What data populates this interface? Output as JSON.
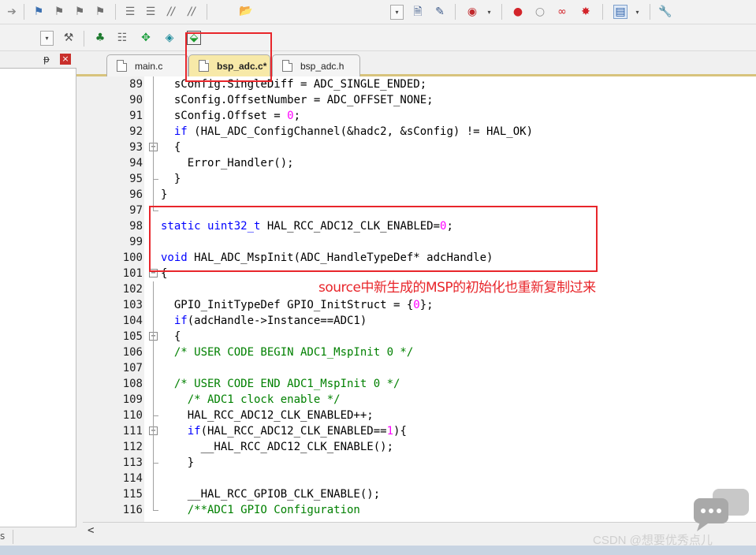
{
  "toolbar1": {
    "icons": [
      "forward-arrow-icon",
      "bookmark-set-icon",
      "bookmark-prev-icon",
      "bookmark-next-icon",
      "bookmark-clear-icon",
      "indent-icon",
      "unindent-icon",
      "comment-icon",
      "uncomment-icon",
      "open-project-icon",
      "file-find-icon",
      "incremental-find-icon",
      "debug-start-icon",
      "breakpoint-insert-icon",
      "breakpoint-enable-icon",
      "breakpoint-disable-icon",
      "breakpoint-kill-all-icon",
      "window-layout-icon",
      "configure-icon"
    ],
    "dropdown_glyph": "▾"
  },
  "toolbar2": {
    "icons": [
      "target-options-icon",
      "manage-components-icon",
      "select-packs-icon",
      "run-time-env-icon",
      "pack-installer-icon",
      "batch-build-icon"
    ]
  },
  "left_panel": {
    "pin_glyph": "ᵽ",
    "close_glyph": "×",
    "footer_text": "s"
  },
  "tabs": [
    {
      "label": "main.c",
      "active": false
    },
    {
      "label": "bsp_adc.c*",
      "active": true
    },
    {
      "label": "bsp_adc.h",
      "active": false
    }
  ],
  "editor": {
    "lines": [
      {
        "num": "89",
        "text": "  sConfig.SingleDiff = ADC_SINGLE_ENDED;"
      },
      {
        "num": "90",
        "text": "  sConfig.OffsetNumber = ADC_OFFSET_NONE;"
      },
      {
        "num": "91",
        "text": "  sConfig.Offset = 0;"
      },
      {
        "num": "92",
        "text": "  if (HAL_ADC_ConfigChannel(&hadc2, &sConfig) != HAL_OK)"
      },
      {
        "num": "93",
        "text": "  {"
      },
      {
        "num": "94",
        "text": "    Error_Handler();"
      },
      {
        "num": "95",
        "text": "  }"
      },
      {
        "num": "96",
        "text": "}"
      },
      {
        "num": "97",
        "text": ""
      },
      {
        "num": "98",
        "text": "static uint32_t HAL_RCC_ADC12_CLK_ENABLED=0;"
      },
      {
        "num": "99",
        "text": ""
      },
      {
        "num": "100",
        "text": "void HAL_ADC_MspInit(ADC_HandleTypeDef* adcHandle)"
      },
      {
        "num": "101",
        "text": "{"
      },
      {
        "num": "102",
        "text": ""
      },
      {
        "num": "103",
        "text": "  GPIO_InitTypeDef GPIO_InitStruct = {0};"
      },
      {
        "num": "104",
        "text": "  if(adcHandle->Instance==ADC1)"
      },
      {
        "num": "105",
        "text": "  {"
      },
      {
        "num": "106",
        "text": "  /* USER CODE BEGIN ADC1_MspInit 0 */"
      },
      {
        "num": "107",
        "text": ""
      },
      {
        "num": "108",
        "text": "  /* USER CODE END ADC1_MspInit 0 */"
      },
      {
        "num": "109",
        "text": "    /* ADC1 clock enable */"
      },
      {
        "num": "110",
        "text": "    HAL_RCC_ADC12_CLK_ENABLED++;"
      },
      {
        "num": "111",
        "text": "    if(HAL_RCC_ADC12_CLK_ENABLED==1){"
      },
      {
        "num": "112",
        "text": "      __HAL_RCC_ADC12_CLK_ENABLE();"
      },
      {
        "num": "113",
        "text": "    }"
      },
      {
        "num": "114",
        "text": ""
      },
      {
        "num": "115",
        "text": "    __HAL_RCC_GPIOB_CLK_ENABLE();"
      },
      {
        "num": "116",
        "text": "    /**ADC1 GPIO Configuration"
      }
    ],
    "scroll_left_glyph": "<"
  },
  "annotation": {
    "text": "source中新生成的MSP的初始化也重新复制过来"
  },
  "watermark": {
    "text": "CSDN @想要优秀点儿"
  },
  "colors": {
    "keyword": "#0000ff",
    "comment": "#008000",
    "number": "#ff00ff",
    "highlight_red": "#e8262b",
    "active_tab": "#f7e9a8"
  }
}
